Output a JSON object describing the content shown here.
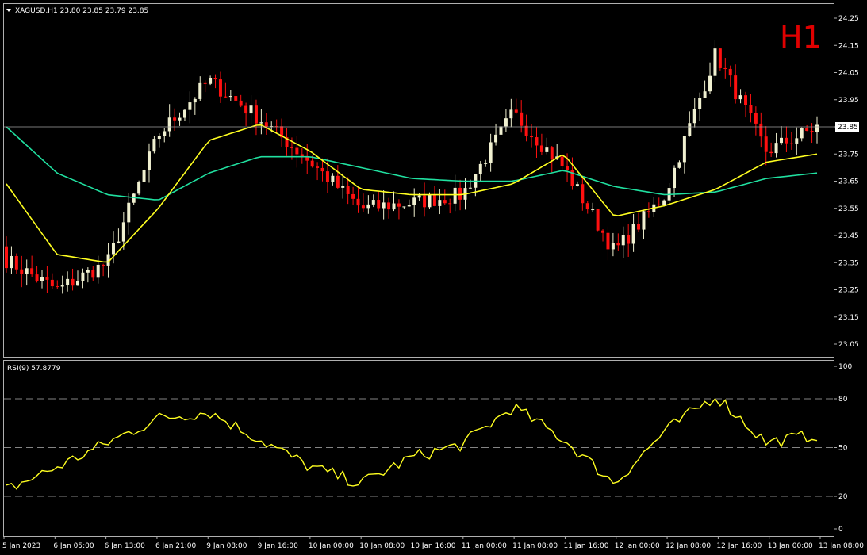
{
  "header": {
    "symbol_line": "XAGUSD,H1  23.80 23.85 23.79 23.85",
    "timeframe_label": "H1",
    "rsi_label": "RSI(9) 57.8779"
  },
  "price_axis": {
    "ticks": [
      "24.25",
      "24.15",
      "24.05",
      "23.95",
      "23.85",
      "23.75",
      "23.65",
      "23.55",
      "23.45",
      "23.35",
      "23.25",
      "23.15",
      "23.05"
    ],
    "current_price": "23.85"
  },
  "rsi_axis": {
    "ticks": [
      "100",
      "80",
      "50",
      "20",
      "0"
    ]
  },
  "time_axis": {
    "ticks": [
      "5 Jan 2023",
      "6 Jan 05:00",
      "6 Jan 13:00",
      "6 Jan 21:00",
      "9 Jan 08:00",
      "9 Jan 16:00",
      "10 Jan 00:00",
      "10 Jan 08:00",
      "10 Jan 16:00",
      "11 Jan 00:00",
      "11 Jan 08:00",
      "11 Jan 16:00",
      "12 Jan 00:00",
      "12 Jan 08:00",
      "12 Jan 16:00",
      "13 Jan 00:00",
      "13 Jan 08:00"
    ]
  },
  "colors": {
    "bull": "#f0f0d0",
    "bear": "#ff1010",
    "ma_fast": "#ffff20",
    "ma_slow": "#20e0a0",
    "rsi_line": "#ffff20",
    "grid": "#b0b0b0"
  },
  "chart_data": [
    {
      "type": "candlestick",
      "symbol": "XAGUSD",
      "timeframe": "H1",
      "ylim": [
        23.0,
        24.3
      ],
      "x": [
        "5 Jan 2023",
        "6 Jan 05:00",
        "6 Jan 13:00",
        "6 Jan 21:00",
        "9 Jan 08:00",
        "9 Jan 16:00",
        "10 Jan 00:00",
        "10 Jan 08:00",
        "10 Jan 16:00",
        "11 Jan 00:00",
        "11 Jan 08:00",
        "11 Jan 16:00",
        "12 Jan 00:00",
        "12 Jan 08:00",
        "12 Jan 16:00",
        "13 Jan 00:00",
        "13 Jan 08:00"
      ],
      "close_anchors": [
        23.36,
        23.25,
        23.35,
        23.82,
        24.02,
        23.88,
        23.72,
        23.55,
        23.57,
        23.6,
        23.9,
        23.7,
        23.39,
        23.6,
        24.12,
        23.76,
        23.85
      ],
      "ma_fast": [
        23.64,
        23.38,
        23.35,
        23.55,
        23.8,
        23.86,
        23.76,
        23.62,
        23.6,
        23.6,
        23.64,
        23.75,
        23.52,
        23.56,
        23.62,
        23.72,
        23.75
      ],
      "ma_slow": [
        23.85,
        23.68,
        23.6,
        23.58,
        23.68,
        23.74,
        23.74,
        23.7,
        23.66,
        23.65,
        23.65,
        23.69,
        23.63,
        23.6,
        23.61,
        23.66,
        23.68
      ]
    },
    {
      "type": "line",
      "name": "RSI(9)",
      "ylim": [
        0,
        100
      ],
      "levels": [
        20,
        50,
        80
      ],
      "x": [
        "5 Jan 2023",
        "6 Jan 05:00",
        "6 Jan 13:00",
        "6 Jan 21:00",
        "9 Jan 08:00",
        "9 Jan 16:00",
        "10 Jan 00:00",
        "10 Jan 08:00",
        "10 Jan 16:00",
        "11 Jan 00:00",
        "11 Jan 08:00",
        "11 Jan 16:00",
        "12 Jan 00:00",
        "12 Jan 08:00",
        "12 Jan 16:00",
        "13 Jan 00:00",
        "13 Jan 08:00"
      ],
      "values": [
        24,
        38,
        53,
        68,
        72,
        55,
        38,
        28,
        44,
        52,
        75,
        55,
        28,
        60,
        82,
        53,
        58
      ]
    }
  ]
}
